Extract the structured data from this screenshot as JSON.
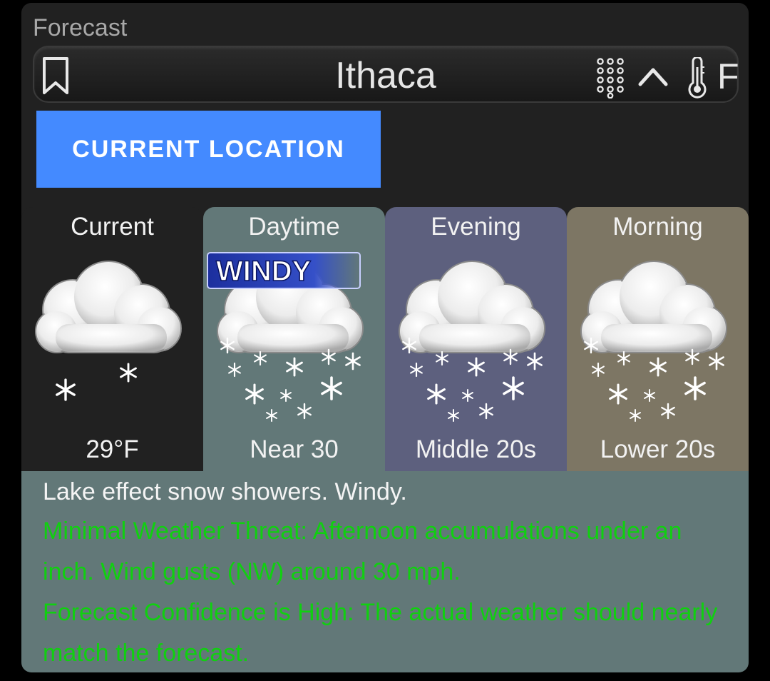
{
  "section_title": "Forecast",
  "location": {
    "city": "Ithaca",
    "unit": "F",
    "icons": [
      "bookmark-icon",
      "dialpad-icon",
      "chevron-up-icon",
      "thermometer-icon"
    ]
  },
  "current_location_button": "CURRENT LOCATION",
  "periods": [
    {
      "label": "Current",
      "temp": "29°F",
      "icon": "cloud-light-snow-icon",
      "bg": "#212121"
    },
    {
      "label": "Daytime",
      "temp": "Near 30",
      "icon": "cloud-snow-icon",
      "bg": "#627878",
      "badge": "WINDY"
    },
    {
      "label": "Evening",
      "temp": "Middle 20s",
      "icon": "cloud-snow-icon",
      "bg": "#5d607e"
    },
    {
      "label": "Morning",
      "temp": "Lower 20s",
      "icon": "cloud-snow-icon",
      "bg": "#7d7664"
    }
  ],
  "description": {
    "main": "Lake effect snow showers. Windy.",
    "threat": "Minimal Weather Threat: Afternoon accumulations under an inch. Wind gusts (NW) around 30 mph.",
    "confidence": "Forecast Confidence is High: The actual weather should nearly match the forecast."
  },
  "colors": {
    "accent_button": "#448aff",
    "threat_text": "#10d010",
    "description_bg": "#627878"
  }
}
